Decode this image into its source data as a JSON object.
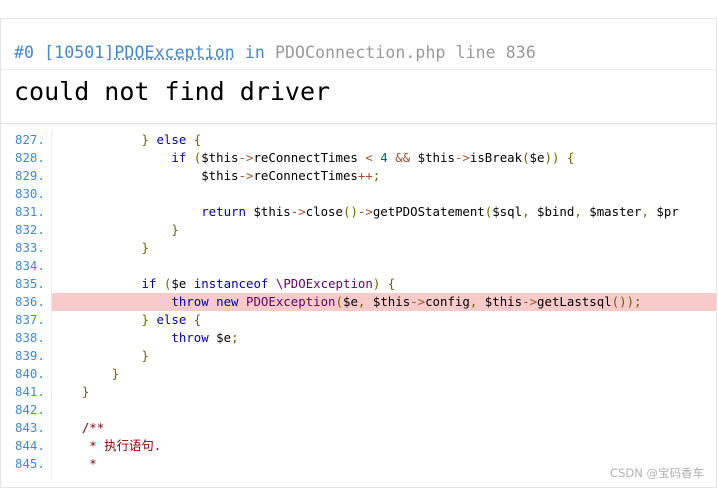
{
  "exception": {
    "index": "#0",
    "code": "[10501]",
    "class": "PDOException",
    "in_word": "in",
    "file": "PDOConnection.php",
    "line_word": "line",
    "line": "836",
    "message": "could not find driver"
  },
  "source": {
    "highlight_line": "836.",
    "lines": [
      {
        "n": "827.",
        "code": "            } else {"
      },
      {
        "n": "828.",
        "code": "                if ($this->reConnectTimes < 4 && $this->isBreak($e)) {"
      },
      {
        "n": "829.",
        "code": "                    $this->reConnectTimes++;"
      },
      {
        "n": "830.",
        "code": ""
      },
      {
        "n": "831.",
        "code": "                    return $this->close()->getPDOStatement($sql, $bind, $master, $pr"
      },
      {
        "n": "832.",
        "code": "                }"
      },
      {
        "n": "833.",
        "code": "            }"
      },
      {
        "n": "834.",
        "code": ""
      },
      {
        "n": "835.",
        "code": "            if ($e instanceof \\PDOException) {"
      },
      {
        "n": "836.",
        "code": "                throw new PDOException($e, $this->config, $this->getLastsql());"
      },
      {
        "n": "837.",
        "code": "            } else {"
      },
      {
        "n": "838.",
        "code": "                throw $e;"
      },
      {
        "n": "839.",
        "code": "            }"
      },
      {
        "n": "840.",
        "code": "        }"
      },
      {
        "n": "841.",
        "code": "    }"
      },
      {
        "n": "842.",
        "code": ""
      },
      {
        "n": "843.",
        "code": "    /**"
      },
      {
        "n": "844.",
        "code": "     * 执行语句."
      },
      {
        "n": "845.",
        "code": "     *"
      }
    ]
  },
  "watermark": "CSDN @宝码香车"
}
